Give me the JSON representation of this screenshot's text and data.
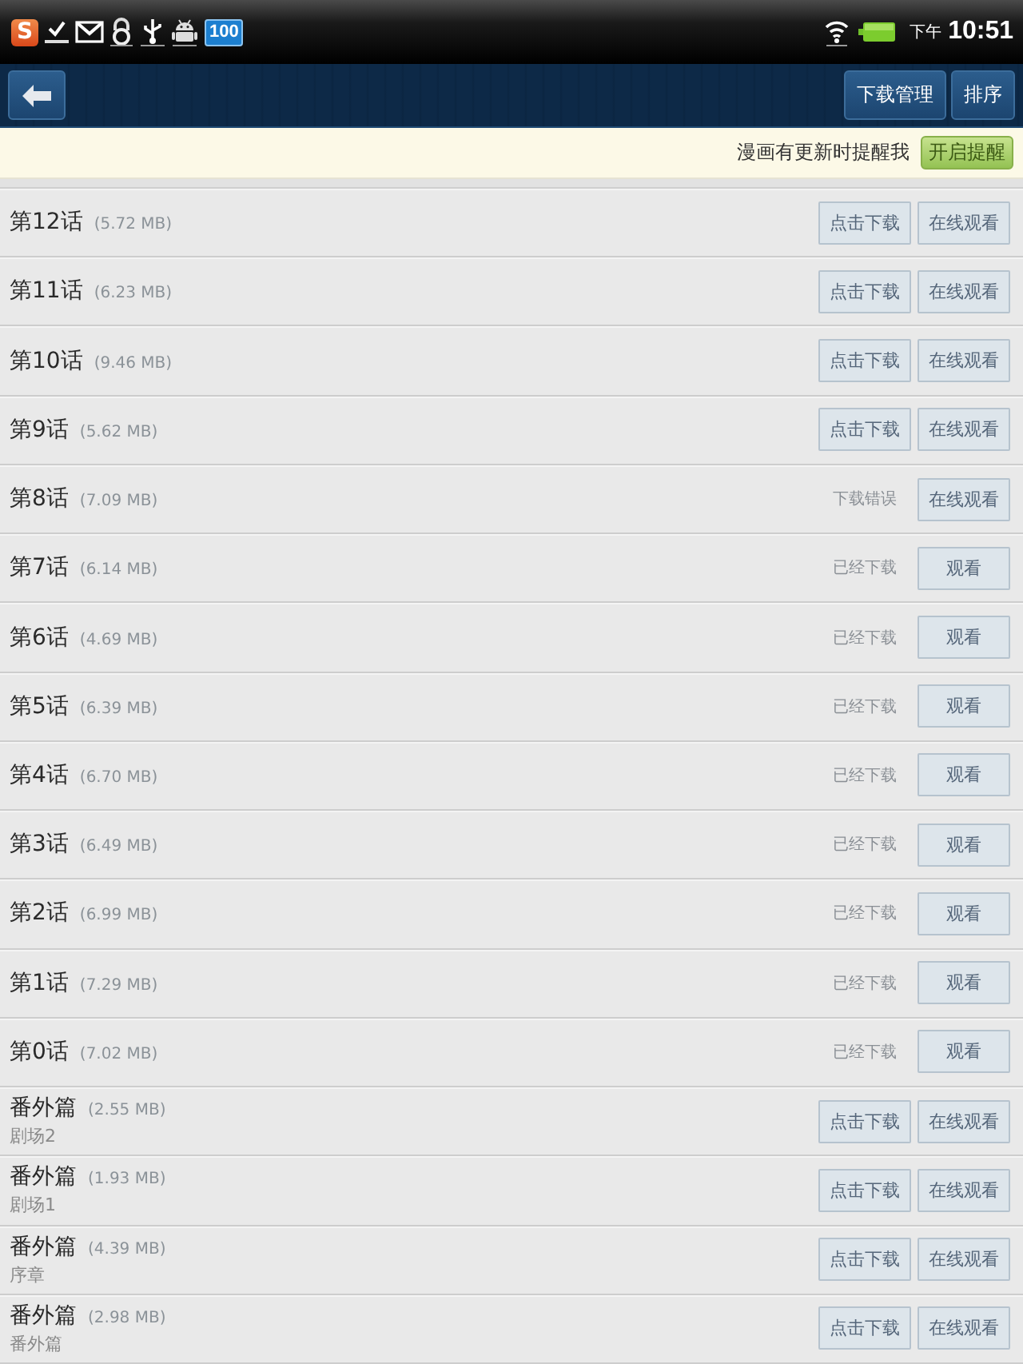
{
  "status_bar": {
    "app_badge": "S",
    "count_badge": "100",
    "period": "下午",
    "time": "10:51"
  },
  "header": {
    "buttons": [
      "下载管理",
      "排序"
    ]
  },
  "notice": {
    "text": "漫画有更新时提醒我",
    "button": "开启提醒"
  },
  "chapters": [
    {
      "title": "第12话",
      "size": "(5.72 MB)",
      "status": {
        "kind": "button",
        "label": "点击下载"
      },
      "view": "在线观看"
    },
    {
      "title": "第11话",
      "size": "(6.23 MB)",
      "status": {
        "kind": "button",
        "label": "点击下载"
      },
      "view": "在线观看"
    },
    {
      "title": "第10话",
      "size": "(9.46 MB)",
      "status": {
        "kind": "button",
        "label": "点击下载"
      },
      "view": "在线观看"
    },
    {
      "title": "第9话",
      "size": "(5.62 MB)",
      "status": {
        "kind": "button",
        "label": "点击下载"
      },
      "view": "在线观看"
    },
    {
      "title": "第8话",
      "size": "(7.09 MB)",
      "status": {
        "kind": "text",
        "label": "下载错误"
      },
      "view": "在线观看"
    },
    {
      "title": "第7话",
      "size": "(6.14 MB)",
      "status": {
        "kind": "text",
        "label": "已经下载"
      },
      "view": "观看"
    },
    {
      "title": "第6话",
      "size": "(4.69 MB)",
      "status": {
        "kind": "text",
        "label": "已经下载"
      },
      "view": "观看"
    },
    {
      "title": "第5话",
      "size": "(6.39 MB)",
      "status": {
        "kind": "text",
        "label": "已经下载"
      },
      "view": "观看"
    },
    {
      "title": "第4话",
      "size": "(6.70 MB)",
      "status": {
        "kind": "text",
        "label": "已经下载"
      },
      "view": "观看"
    },
    {
      "title": "第3话",
      "size": "(6.49 MB)",
      "status": {
        "kind": "text",
        "label": "已经下载"
      },
      "view": "观看"
    },
    {
      "title": "第2话",
      "size": "(6.99 MB)",
      "status": {
        "kind": "text",
        "label": "已经下载"
      },
      "view": "观看"
    },
    {
      "title": "第1话",
      "size": "(7.29 MB)",
      "status": {
        "kind": "text",
        "label": "已经下载"
      },
      "view": "观看"
    },
    {
      "title": "第0话",
      "size": "(7.02 MB)",
      "status": {
        "kind": "text",
        "label": "已经下载"
      },
      "view": "观看"
    },
    {
      "title": "番外篇",
      "size": "(2.55 MB)",
      "subtitle": "剧场2",
      "status": {
        "kind": "button",
        "label": "点击下载"
      },
      "view": "在线观看"
    },
    {
      "title": "番外篇",
      "size": "(1.93 MB)",
      "subtitle": "剧场1",
      "status": {
        "kind": "button",
        "label": "点击下载"
      },
      "view": "在线观看"
    },
    {
      "title": "番外篇",
      "size": "(4.39 MB)",
      "subtitle": "序章",
      "status": {
        "kind": "button",
        "label": "点击下载"
      },
      "view": "在线观看"
    },
    {
      "title": "番外篇",
      "size": "(2.98 MB)",
      "subtitle": "番外篇",
      "status": {
        "kind": "button",
        "label": "点击下载"
      },
      "view": "在线观看"
    }
  ]
}
